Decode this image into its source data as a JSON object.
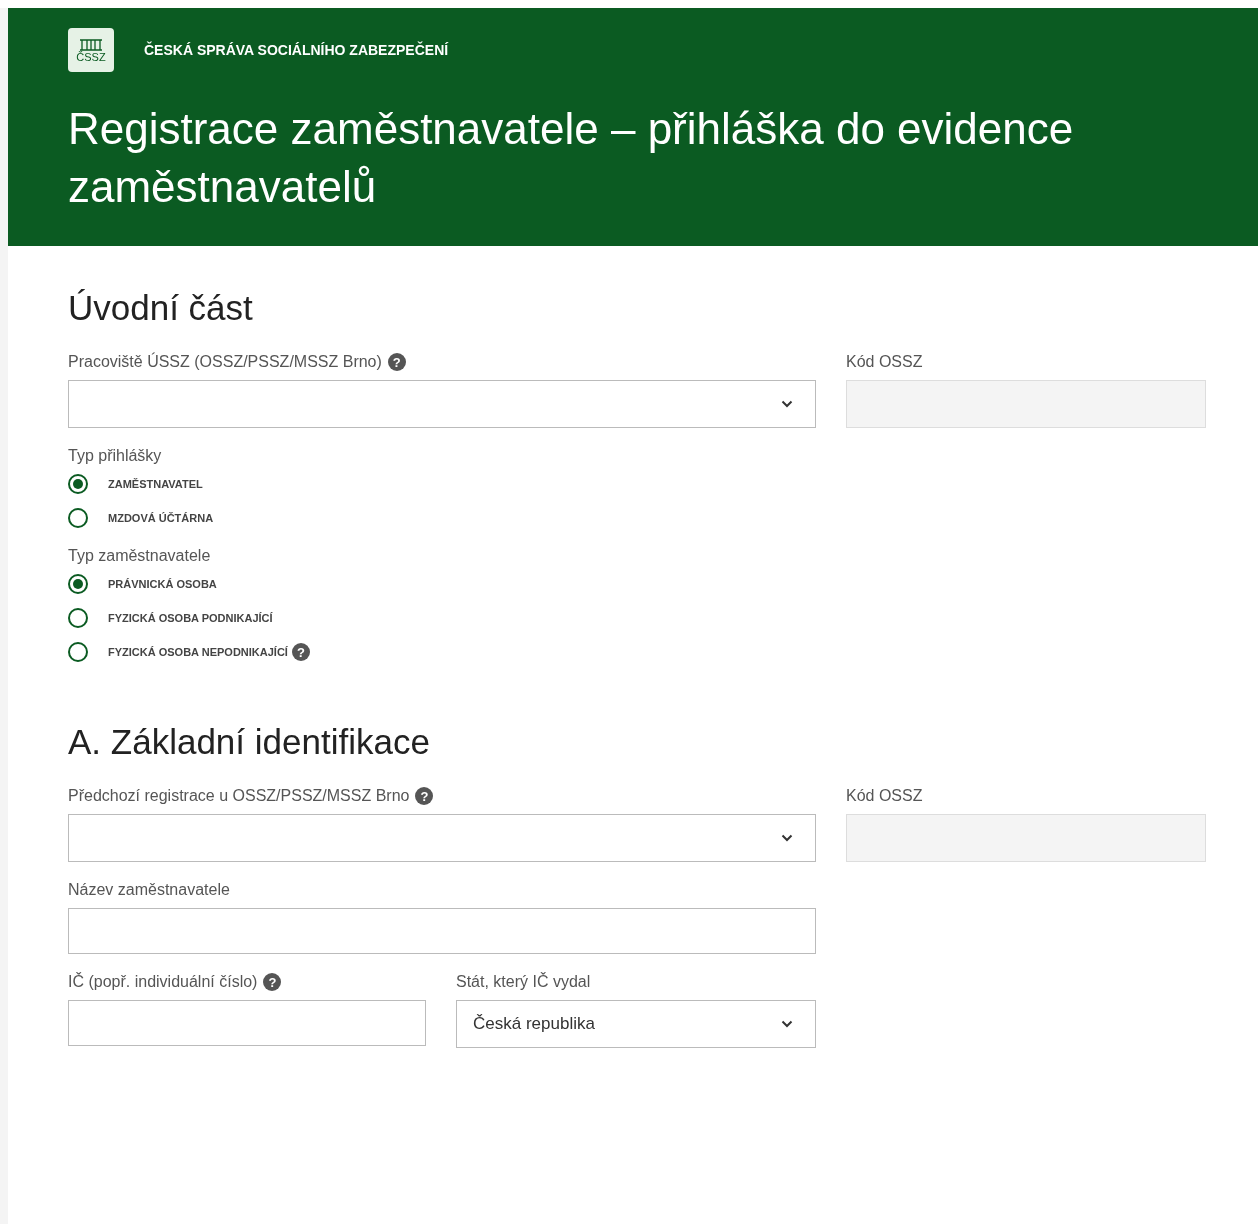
{
  "header": {
    "logo_text": "ČSSZ",
    "agency": "ČESKÁ SPRÁVA SOCIÁLNÍHO ZABEZPEČENÍ",
    "title": "Registrace zaměstnavatele – přihláška do evidence zaměstnavatelů"
  },
  "sections": [
    {
      "heading": "Úvodní část",
      "rows": [
        {
          "kind": "main-side",
          "fields": [
            {
              "kind": "select",
              "label": "Pracoviště ÚSSZ (OSSZ/PSSZ/MSSZ Brno)",
              "help_icon": "?"
            },
            {
              "kind": "readonly",
              "label": "Kód OSSZ"
            }
          ]
        },
        {
          "kind": "main",
          "fields": [
            {
              "kind": "radio-group",
              "label": "Typ přihlášky",
              "options": [
                {
                  "label": "ZAMĚSTNAVATEL",
                  "selected": true
                },
                {
                  "label": "MZDOVÁ ÚČTÁRNA",
                  "selected": false
                }
              ]
            }
          ]
        },
        {
          "kind": "main",
          "fields": [
            {
              "kind": "radio-group",
              "label": "Typ zaměstnavatele",
              "options": [
                {
                  "label": "PRÁVNICKÁ OSOBA",
                  "selected": true
                },
                {
                  "label": "FYZICKÁ OSOBA PODNIKAJÍCÍ",
                  "selected": false
                },
                {
                  "label": "FYZICKÁ OSOBA NEPODNIKAJÍCÍ",
                  "selected": false,
                  "help_icon": "?"
                }
              ]
            }
          ]
        }
      ]
    },
    {
      "heading": "A. Základní identifikace",
      "rows": [
        {
          "kind": "main-side",
          "fields": [
            {
              "kind": "select",
              "label": "Předchozí registrace u OSSZ/PSSZ/MSSZ Brno",
              "help_icon": "?"
            },
            {
              "kind": "readonly",
              "label": "Kód OSSZ"
            }
          ]
        },
        {
          "kind": "main",
          "fields": [
            {
              "kind": "text",
              "label": "Název zaměstnavatele"
            }
          ]
        },
        {
          "kind": "pair",
          "fields": [
            {
              "kind": "text",
              "label": "IČ (popř. individuální číslo)",
              "help_icon": "?"
            },
            {
              "kind": "select",
              "label": "Stát, který IČ vydal",
              "value": "Česká republika"
            }
          ]
        }
      ]
    }
  ]
}
